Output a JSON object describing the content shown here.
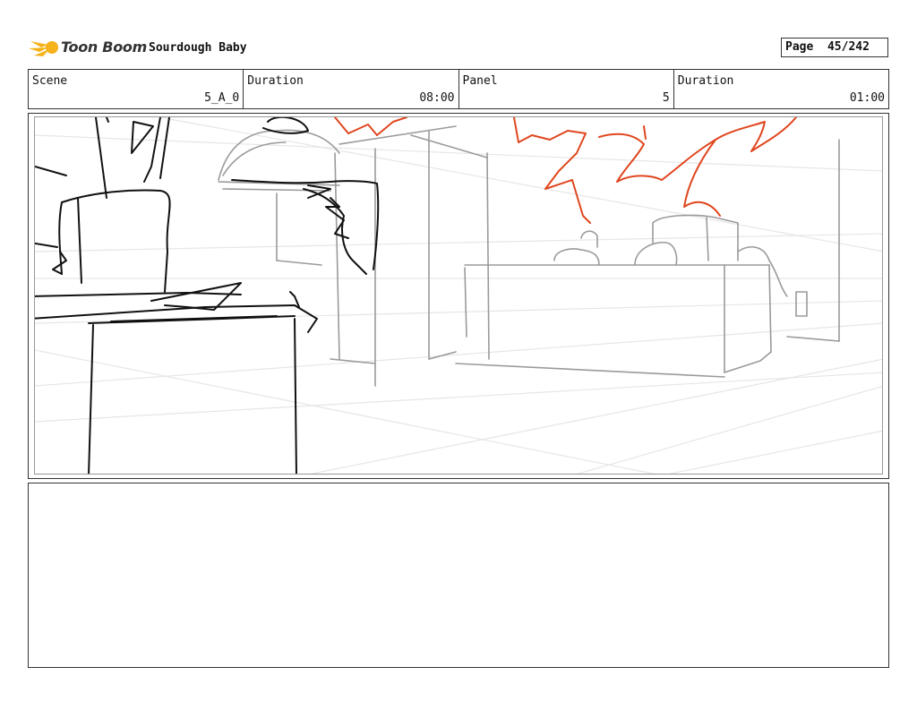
{
  "header": {
    "logo_text": "Toon Boom",
    "project_title": "Sourdough Baby",
    "page_label": "Page",
    "page_number": "45/242"
  },
  "info": {
    "scene_label": "Scene",
    "scene_value": "5_A_0",
    "scene_duration_label": "Duration",
    "scene_duration_value": "08:00",
    "panel_label": "Panel",
    "panel_value": "5",
    "panel_duration_label": "Duration",
    "panel_duration_value": "01:00"
  },
  "colors": {
    "logo_yellow": "#f5b21a",
    "sketch_black": "#111111",
    "sketch_grey": "#9a9a9a",
    "sketch_red": "#e0461e",
    "guide_lines": "#e4e4e4"
  },
  "notes": {
    "text": ""
  }
}
